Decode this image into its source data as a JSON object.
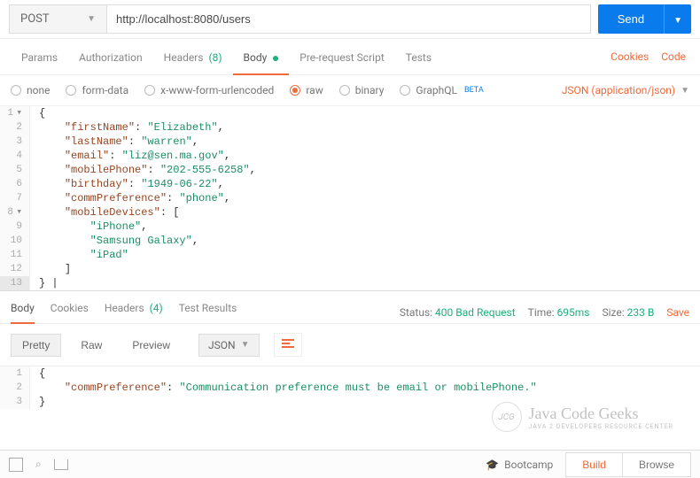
{
  "request": {
    "method": "POST",
    "url": "http://localhost:8080/users",
    "send_label": "Send"
  },
  "tabs": {
    "params": "Params",
    "authorization": "Authorization",
    "headers": "Headers",
    "headers_count": "(8)",
    "body": "Body",
    "prerequest": "Pre-request Script",
    "tests": "Tests",
    "cookies_link": "Cookies",
    "code_link": "Code"
  },
  "body_types": {
    "none": "none",
    "formdata": "form-data",
    "urlencoded": "x-www-form-urlencoded",
    "raw": "raw",
    "binary": "binary",
    "graphql": "GraphQL",
    "beta": "BETA",
    "content_type": "JSON (application/json)"
  },
  "request_body": {
    "firstName": "Elizabeth",
    "lastName": "warren",
    "email": "liz@sen.ma.gov",
    "mobilePhone": "202-555-6258",
    "birthday": "1949-06-22",
    "commPreference": "phone",
    "mobileDevices": [
      "iPhone",
      "Samsung Galaxy",
      "iPad"
    ]
  },
  "response_tabs": {
    "body": "Body",
    "cookies": "Cookies",
    "headers": "Headers",
    "headers_count": "(4)",
    "test_results": "Test Results"
  },
  "response_meta": {
    "status_label": "Status:",
    "status_value": "400 Bad Request",
    "time_label": "Time:",
    "time_value": "695ms",
    "size_label": "Size:",
    "size_value": "233 B",
    "save": "Save"
  },
  "view": {
    "pretty": "Pretty",
    "raw": "Raw",
    "preview": "Preview",
    "fmt": "JSON"
  },
  "response_body": {
    "commPreference": "Communication preference must be email or mobilePhone."
  },
  "footer": {
    "bootcamp": "Bootcamp",
    "build": "Build",
    "browse": "Browse"
  },
  "watermark": {
    "brand": "Java Code Geeks",
    "sub": "JAVA 2 DEVELOPERS RESOURCE CENTER",
    "logo": "JCG"
  }
}
